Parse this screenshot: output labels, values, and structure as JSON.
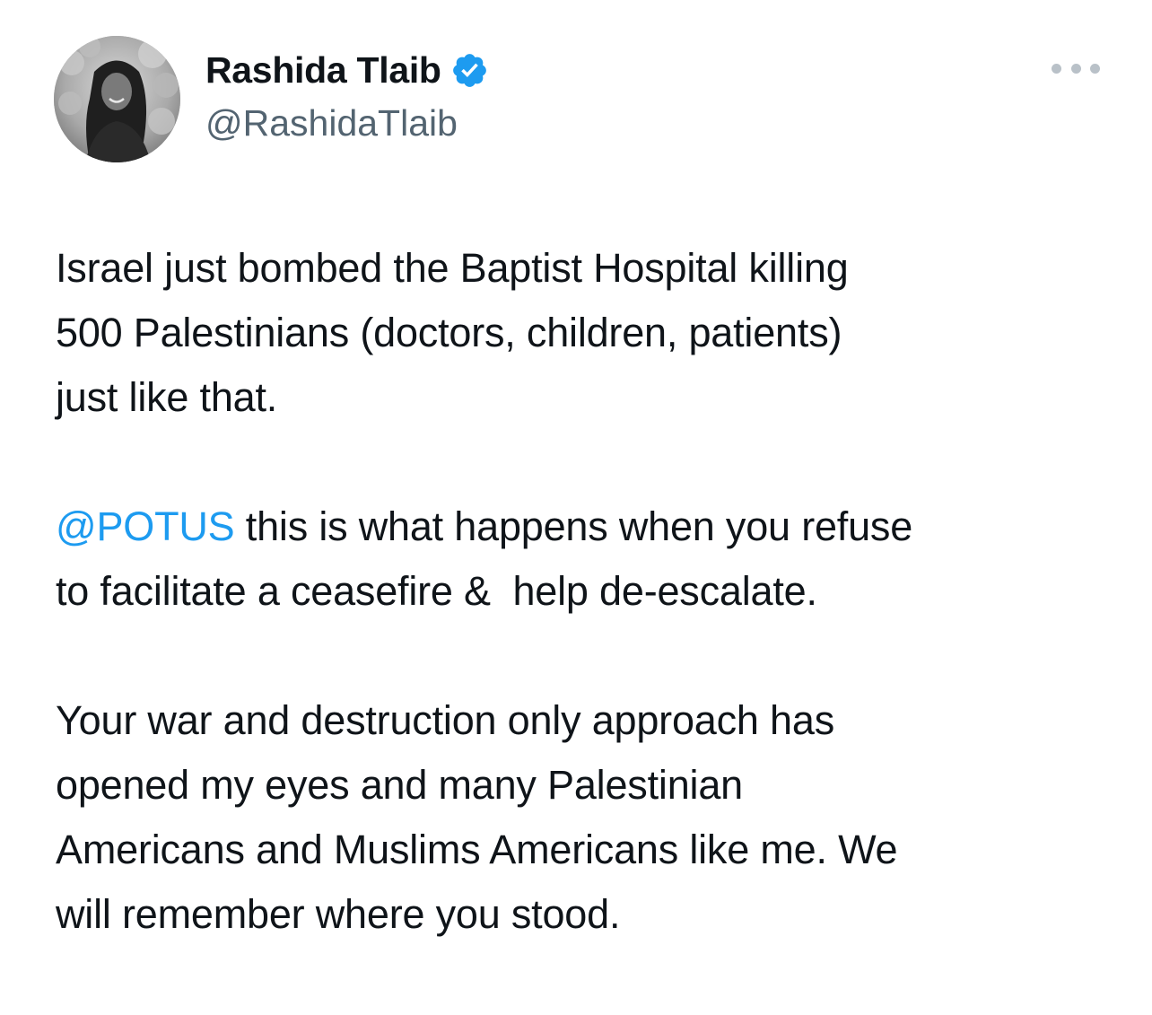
{
  "author": {
    "display_name": "Rashida Tlaib",
    "handle": "@RashidaTlaib",
    "verified": true,
    "verified_color": "#1d9bf0",
    "avatar_icon": "profile-photo-grayscale"
  },
  "more_options_icon": "ellipsis-horizontal-icon",
  "tweet": {
    "paragraph1": {
      "line1": "Israel just bombed the Baptist Hospital killing",
      "line2": "500 Palestinians (doctors, children, patients)",
      "line3": "just like that."
    },
    "paragraph2": {
      "mention": "@POTUS",
      "line1_rest": " this is what happens when you refuse",
      "line2": "to facilitate a ceasefire &  help de-escalate."
    },
    "paragraph3": {
      "line1": "Your war and destruction only approach has",
      "line2": "opened my eyes and many Palestinian",
      "line3": "Americans and Muslims Americans like me. We",
      "line4": "will remember where you stood."
    }
  },
  "colors": {
    "text": "#0f1419",
    "secondary_text": "#536471",
    "link": "#1d9bf0",
    "background": "#ffffff"
  }
}
